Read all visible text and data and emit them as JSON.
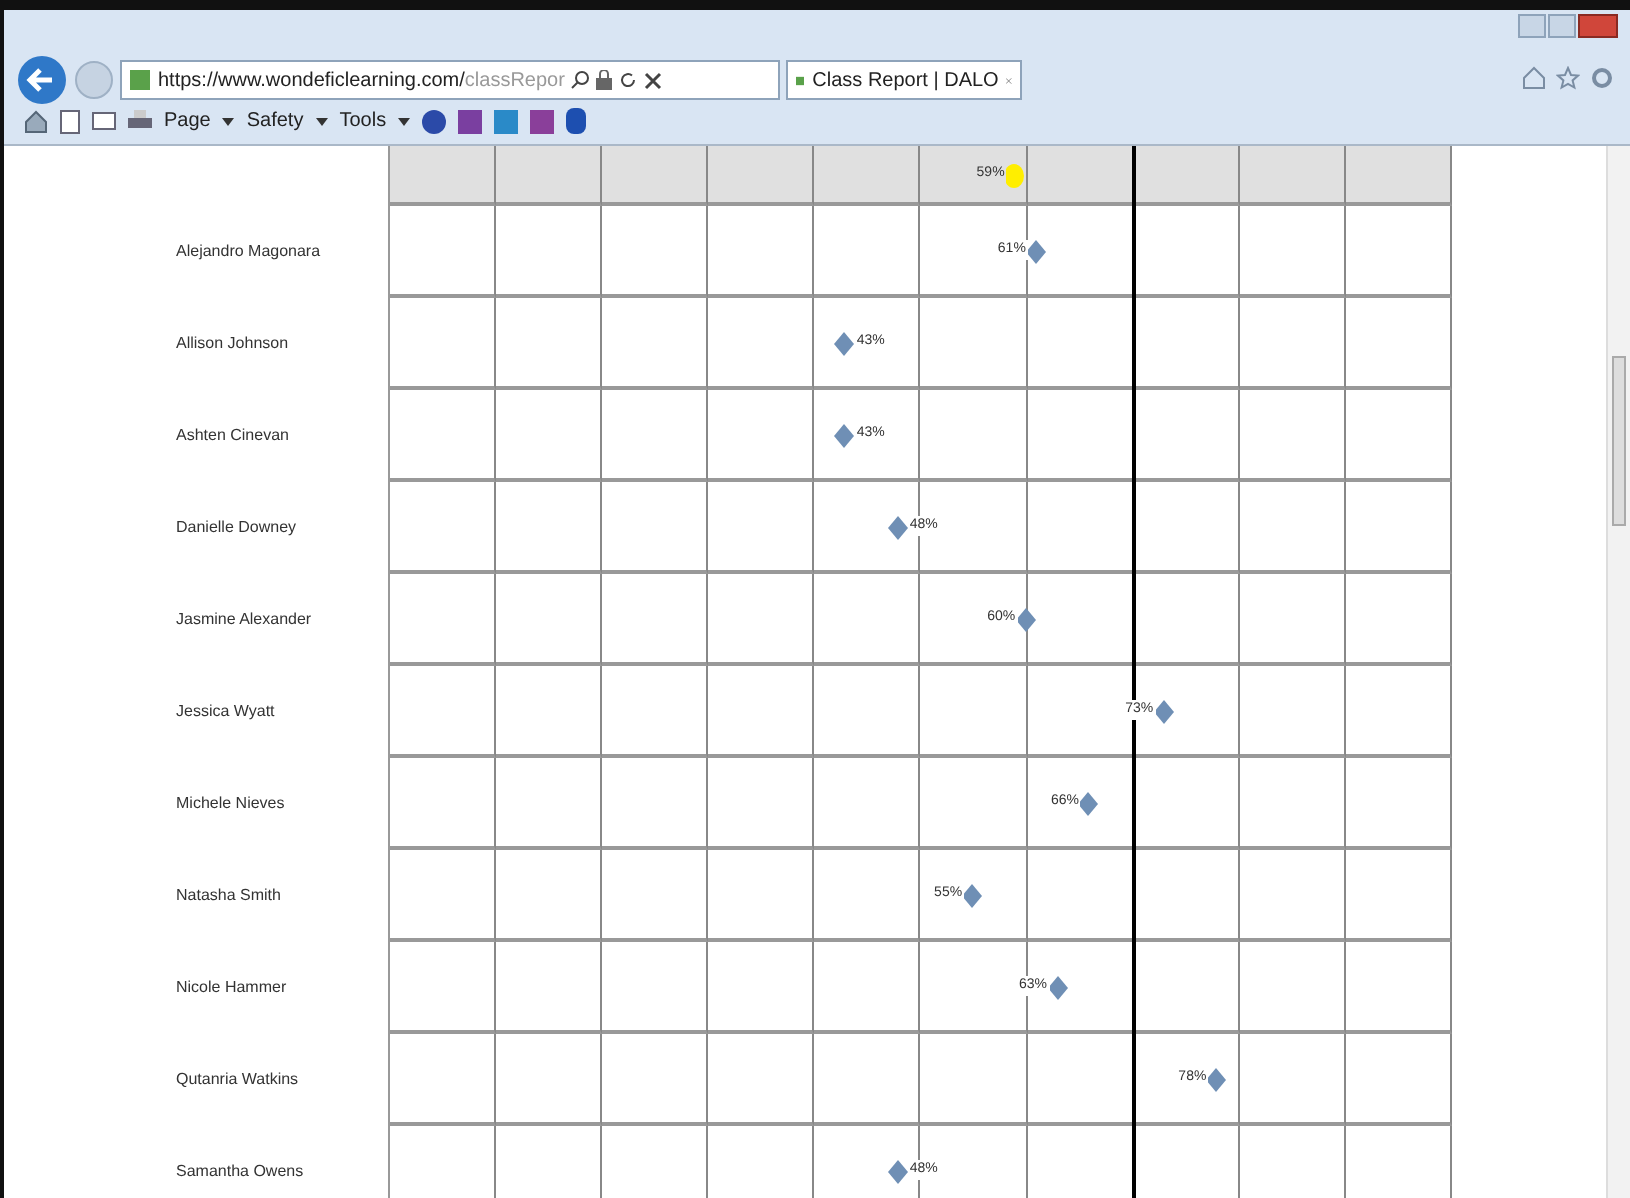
{
  "browser": {
    "address": {
      "url": "https://www.wondeficlearning.com/",
      "url_rest": "classRepor"
    },
    "tabs": [
      {
        "label": "Class Report | DALO",
        "selected": true
      }
    ],
    "toolbar": [
      "Page",
      "Safety",
      "Tools"
    ]
  },
  "report": {
    "header": {
      "label": "59%",
      "level": 0.59
    },
    "target": {
      "level": 0.7
    },
    "rows": [
      {
        "name": "Alejandro Magonara",
        "label": "61%",
        "level": 0.61,
        "kind": "leading"
      },
      {
        "name": "Allison Johnson",
        "label": "43%",
        "level": 0.43,
        "kind": "trailing"
      },
      {
        "name": "Ashten Cinevan",
        "label": "43%",
        "level": 0.43,
        "kind": "trailing"
      },
      {
        "name": "Danielle Downey",
        "label": "48%",
        "level": 0.48,
        "kind": "trailing"
      },
      {
        "name": "Jasmine Alexander",
        "label": "60%",
        "level": 0.6,
        "kind": "leading"
      },
      {
        "name": "Jessica Wyatt",
        "label": "73%",
        "level": 0.73,
        "kind": "leading"
      },
      {
        "name": "Michele Nieves",
        "label": "66%",
        "level": 0.66,
        "kind": "leading"
      },
      {
        "name": "Natasha Smith",
        "label": "55%",
        "level": 0.55,
        "kind": "leading"
      },
      {
        "name": "Nicole Hammer",
        "label": "63%",
        "level": 0.63,
        "kind": "leading"
      },
      {
        "name": "Qutanria Watkins",
        "label": "78%",
        "level": 0.78,
        "kind": "leading"
      },
      {
        "name": "Samantha Owens",
        "label": "48%",
        "level": 0.48,
        "kind": "trailing"
      }
    ]
  }
}
